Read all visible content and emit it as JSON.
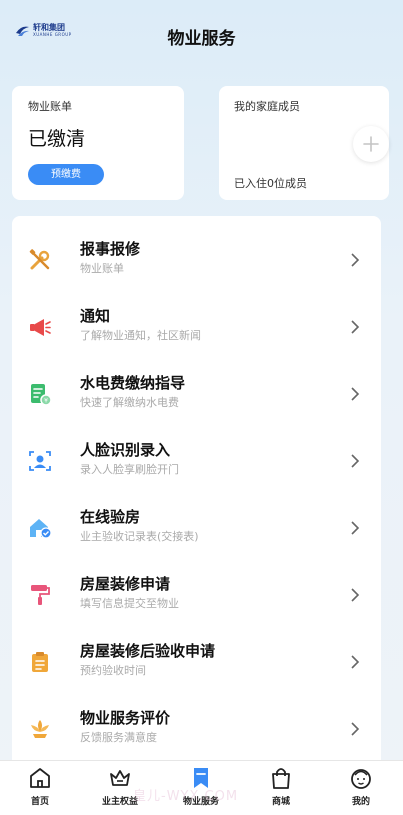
{
  "header": {
    "logo_cn": "轩和集团",
    "logo_en": "XUANHE GROUP",
    "title": "物业服务"
  },
  "bill_card": {
    "label": "物业账单",
    "status": "已缴清",
    "prepay_label": "预缴费"
  },
  "family_card": {
    "label": "我的家庭成员",
    "count_text": "已入住0位成员"
  },
  "services": [
    {
      "title": "报事报修",
      "subtitle": "物业账单",
      "icon": "wrench-icon",
      "color": "#e8a33d"
    },
    {
      "title": "通知",
      "subtitle": "了解物业通知，社区新闻",
      "icon": "megaphone-icon",
      "color": "#e84a4a"
    },
    {
      "title": "水电费缴纳指导",
      "subtitle": "快速了解缴纳水电费",
      "icon": "bill-icon",
      "color": "#3cbc6e"
    },
    {
      "title": "人脸识别录入",
      "subtitle": "录入人脸享刷脸开门",
      "icon": "face-scan-icon",
      "color": "#3a8cf5"
    },
    {
      "title": "在线验房",
      "subtitle": "业主验收记录表(交接表)",
      "icon": "house-check-icon",
      "color": "#4aa3f0"
    },
    {
      "title": "房屋装修申请",
      "subtitle": "填写信息提交至物业",
      "icon": "paint-roller-icon",
      "color": "#e8557a"
    },
    {
      "title": "房屋装修后验收申请",
      "subtitle": "预约验收时间",
      "icon": "clipboard-icon",
      "color": "#f0a73a"
    },
    {
      "title": "物业服务评价",
      "subtitle": "反馈服务满意度",
      "icon": "flower-icon",
      "color": "#f0a73a"
    }
  ],
  "tabs": [
    {
      "label": "首页",
      "icon": "home-icon"
    },
    {
      "label": "业主权益",
      "icon": "crown-icon"
    },
    {
      "label": "物业服务",
      "icon": "bookmark-icon",
      "active": true
    },
    {
      "label": "商城",
      "icon": "shopping-bag-icon"
    },
    {
      "label": "我的",
      "icon": "face-icon"
    }
  ],
  "watermark": "皇儿-WYX.COM",
  "colors": {
    "accent": "#3a8cf5",
    "background_top": "#dcecf8"
  }
}
